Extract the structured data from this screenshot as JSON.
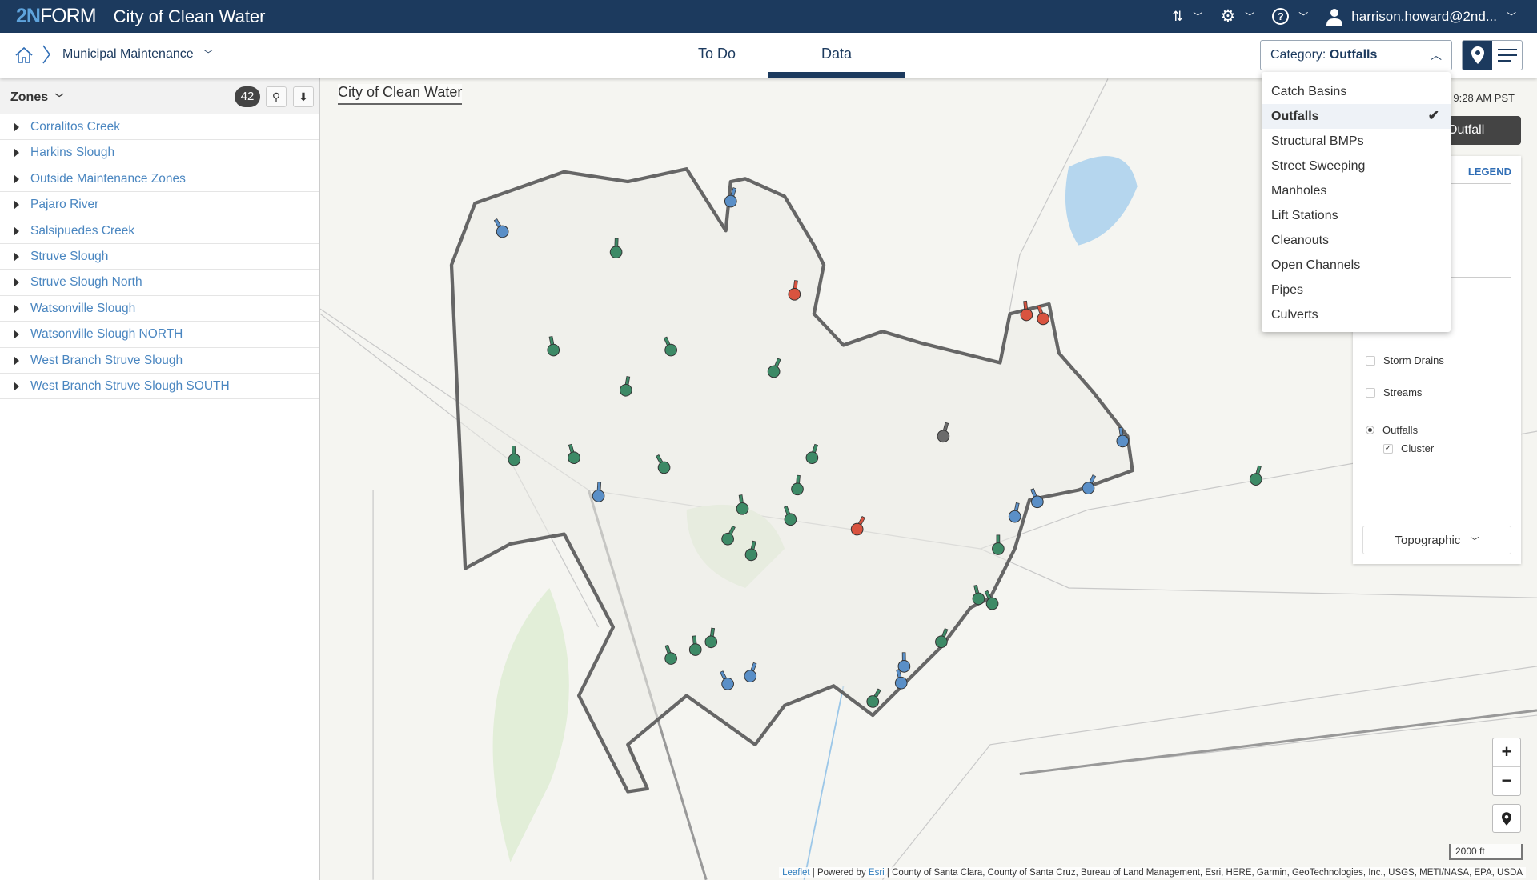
{
  "header": {
    "logo": "2NFORM",
    "logo_prefix": "2N",
    "logo_suffix": "FORM",
    "app_title": "City of Clean Water",
    "user": "harrison.howard@2nd..."
  },
  "nav": {
    "breadcrumb": "Municipal Maintenance",
    "tabs": [
      {
        "label": "To Do"
      },
      {
        "label": "Data",
        "active": true
      }
    ],
    "category_prefix": "Category:",
    "category_value": "Outfalls"
  },
  "category_menu": {
    "items": [
      {
        "label": "Catch Basins"
      },
      {
        "label": "Outfalls",
        "selected": true
      },
      {
        "label": "Structural BMPs"
      },
      {
        "label": "Street Sweeping"
      },
      {
        "label": "Manholes"
      },
      {
        "label": "Lift Stations"
      },
      {
        "label": "Cleanouts"
      },
      {
        "label": "Open Channels"
      },
      {
        "label": "Pipes"
      },
      {
        "label": "Culverts"
      }
    ]
  },
  "sidebar": {
    "title": "Zones",
    "count": "42",
    "zones": [
      "Corralitos Creek",
      "Harkins Slough",
      "Outside Maintenance Zones",
      "Pajaro River",
      "Salsipuedes Creek",
      "Struve Slough",
      "Struve Slough North",
      "Watsonville Slough",
      "Watsonville Slough NORTH",
      "West Branch Struve Slough",
      "West Branch Struve Slough SOUTH"
    ]
  },
  "map": {
    "title": "City of Clean Water",
    "timestamp": "9:28 AM PST",
    "outfall_button": "Outfall",
    "scale": "2000 ft",
    "attribution": {
      "leaflet": "Leaflet",
      "powered": " | Powered by ",
      "esri": "Esri",
      "rest": " | County of Santa Clara, County of Santa Cruz, Bureau of Land Management, Esri, HERE, Garmin, GeoTechnologies, Inc., USGS, METI/NASA, EPA, USDA"
    },
    "marker_colors": {
      "green": "#3d8a66",
      "blue": "#5a8fc7",
      "red": "#d9533f",
      "gray": "#6b6b6b"
    }
  },
  "legend": {
    "tab": "LEGEND",
    "layers": [
      {
        "label": "Storm Drains",
        "checked": false
      },
      {
        "label": "Streams",
        "checked": false
      }
    ],
    "outfalls": "Outfalls",
    "cluster": "Cluster",
    "basemap": "Topographic"
  },
  "colors": {
    "header_bg": "#1c3a5e",
    "link": "#4a86c0"
  }
}
